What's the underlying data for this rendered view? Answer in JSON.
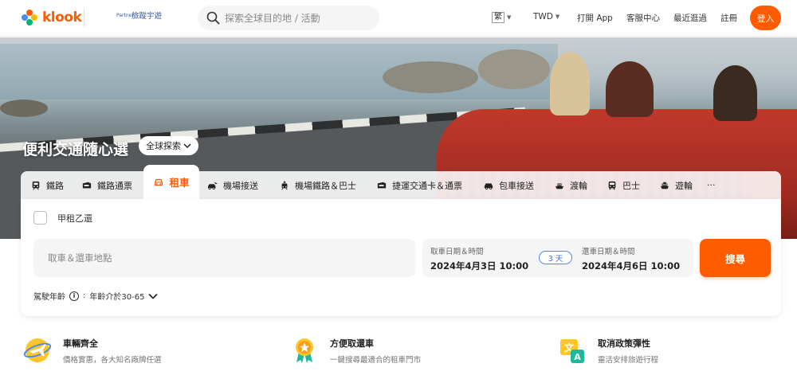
{
  "header": {
    "logo_text": "klook",
    "partner_text": "旅蹤宇遊",
    "partner_badge": "Partner",
    "search_placeholder": "探索全球目的地 / 活動",
    "language": "繁",
    "currency": "TWD",
    "nav_items": [
      "打開 App",
      "客服中心",
      "最近逛過",
      "註冊"
    ],
    "login_label": "登入",
    "accent_color": "#ff5b00"
  },
  "hero": {
    "title": "便利交通隨心選",
    "global_explore": "全球探索"
  },
  "tabs": [
    {
      "label": "鐵路",
      "icon": "train-icon"
    },
    {
      "label": "鐵路通票",
      "icon": "rail-pass-icon"
    },
    {
      "label": "租車",
      "icon": "car-icon",
      "active": true
    },
    {
      "label": "機場接送",
      "icon": "airport-transfer-icon"
    },
    {
      "label": "機場鐵路＆巴士",
      "icon": "airport-rail-bus-icon"
    },
    {
      "label": "捷運交通卡＆通票",
      "icon": "transit-card-icon"
    },
    {
      "label": "包車接送",
      "icon": "private-car-icon"
    },
    {
      "label": "渡輪",
      "icon": "ferry-icon"
    },
    {
      "label": "巴士",
      "icon": "bus-icon"
    },
    {
      "label": "遊輪",
      "icon": "cruise-icon"
    },
    {
      "label": "···",
      "icon": "more-icon"
    }
  ],
  "booking": {
    "different_return_label": "甲租乙還",
    "location_placeholder": "取車＆還車地點",
    "pickup_label": "取車日期＆時間",
    "pickup_value": "2024年4月3日 10:00",
    "duration": "3 天",
    "return_label": "還車日期＆時間",
    "return_value": "2024年4月6日 10:00",
    "search_label": "搜尋",
    "age_label": "駕駛年齡",
    "age_value": "年齡介於30-65"
  },
  "features": [
    {
      "title": "車輛齊全",
      "desc": "價格實惠，各大知名廠牌任選",
      "icon": "airplane-globe-icon"
    },
    {
      "title": "方便取還車",
      "desc": "一鍵搜尋最適合的租車門市",
      "icon": "medal-icon"
    },
    {
      "title": "取消政策彈性",
      "desc": "靈活安排旅遊行程",
      "icon": "translate-icon"
    }
  ]
}
